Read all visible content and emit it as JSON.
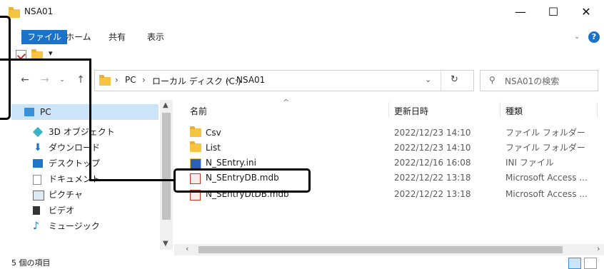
{
  "window": {
    "title": "NSA01",
    "minimize": "—",
    "maximize": "☐",
    "close": "✕",
    "help": "?"
  },
  "ribbon": {
    "tabs": [
      "ファイル",
      "ホーム",
      "共有",
      "表示"
    ]
  },
  "address": {
    "crumbs": [
      "PC",
      "ローカル ディスク (C:)",
      "NSA01"
    ],
    "search_placeholder": "NSA01の検索"
  },
  "sidebar": {
    "items": [
      {
        "label": "PC",
        "icon": "pc-icon"
      },
      {
        "label": "3D オブジェクト",
        "icon": "3d-objects-icon"
      },
      {
        "label": "ダウンロード",
        "icon": "download-icon"
      },
      {
        "label": "デスクトップ",
        "icon": "desktop-icon"
      },
      {
        "label": "ドキュメント",
        "icon": "document-icon"
      },
      {
        "label": "ピクチャ",
        "icon": "pictures-icon"
      },
      {
        "label": "ビデオ",
        "icon": "video-icon"
      },
      {
        "label": "ミュージック",
        "icon": "music-icon"
      }
    ]
  },
  "filelist": {
    "headers": [
      "名前",
      "更新日時",
      "種類"
    ],
    "rows": [
      {
        "name": "Csv",
        "date": "2022/12/23 14:10",
        "type": "ファイル フォルダー",
        "icon": "folder-icon"
      },
      {
        "name": "List",
        "date": "2022/12/23 14:10",
        "type": "ファイル フォルダー",
        "icon": "folder-icon"
      },
      {
        "name": "N_SEntry.ini",
        "date": "2022/12/16 16:08",
        "type": "INI ファイル",
        "icon": "ini-file-icon"
      },
      {
        "name": "N_SEntryDB.mdb",
        "date": "2022/12/22 13:18",
        "type": "Microsoft Access ...",
        "icon": "access-file-icon"
      },
      {
        "name": "N_SEntryDtDB.mdb",
        "date": "2022/12/22 13:18",
        "type": "Microsoft Access ...",
        "icon": "access-file-icon"
      }
    ]
  },
  "status": {
    "count": "5 個の項目"
  },
  "colors": {
    "accent": "#1a73c8",
    "folder": "#f6c343",
    "selection": "#cce4f7",
    "access_red": "#c0392b"
  }
}
